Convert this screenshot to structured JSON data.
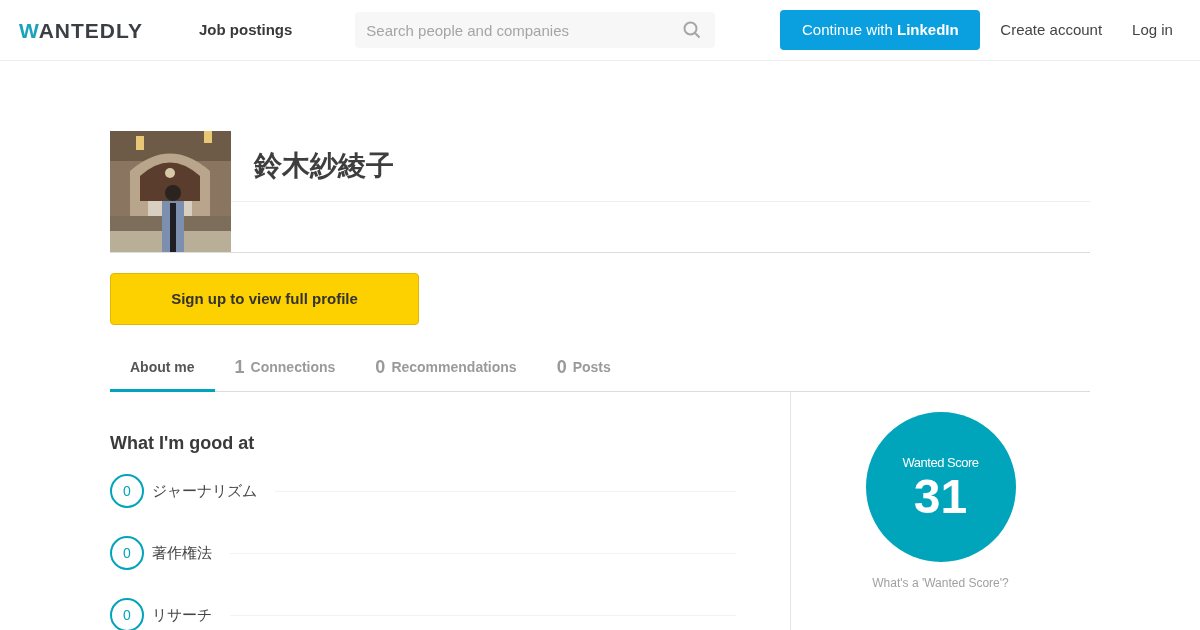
{
  "header": {
    "logo": "WANTEDLY",
    "nav_link": "Job postings",
    "search": {
      "placeholder": "Search people and companies"
    },
    "linkedin_button": "Continue with **LinkedIn**",
    "create_account": "Create account",
    "log_in": "Log in"
  },
  "profile": {
    "name": "鈴木紗綾子",
    "signup_button": "Sign up to view full profile"
  },
  "tabs": [
    {
      "label": "About me",
      "selected": true
    },
    {
      "count": "1",
      "label": "Connections",
      "selected": false
    },
    {
      "count": "0",
      "label": "Recommendations",
      "selected": false
    },
    {
      "count": "0",
      "label": "Posts",
      "selected": false
    }
  ],
  "skills": {
    "title": "What I'm good at",
    "items": [
      {
        "count": "0",
        "label": "ジャーナリズム"
      },
      {
        "count": "0",
        "label": "著作権法"
      },
      {
        "count": "0",
        "label": "リサーチ"
      }
    ]
  },
  "score": {
    "label": "Wanted Score",
    "value": "31",
    "help_link": "What's a 'Wanted Score'?"
  }
}
